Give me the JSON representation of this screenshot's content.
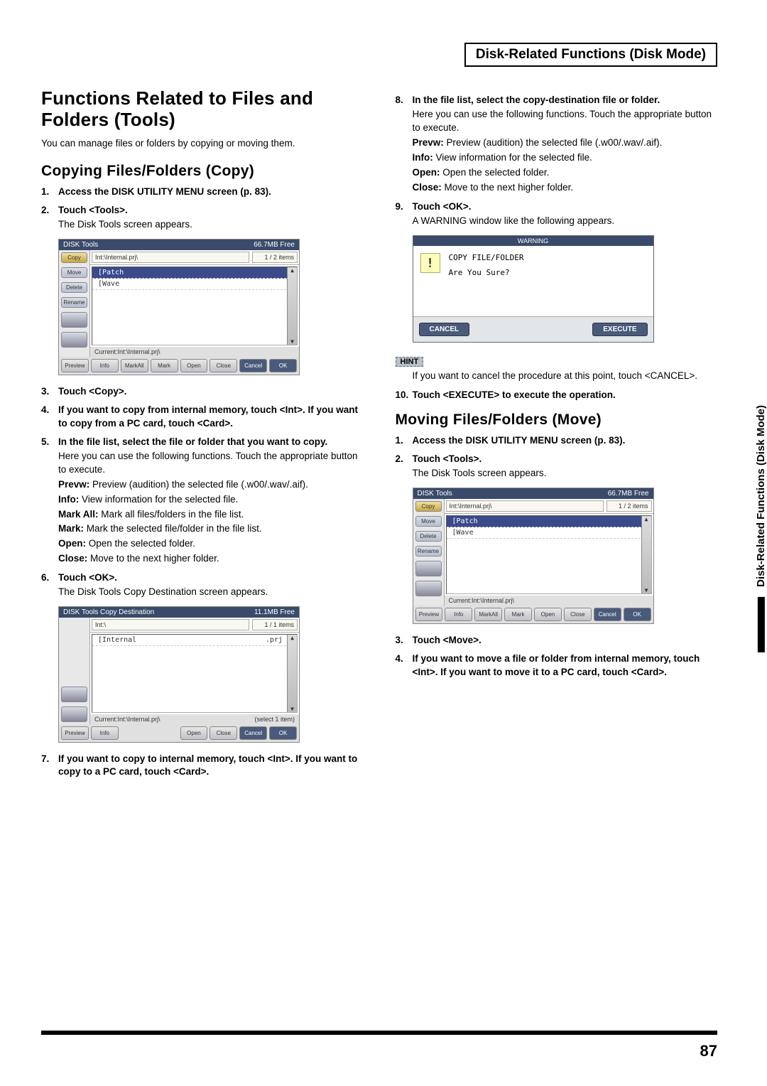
{
  "header_box": "Disk-Related Functions (Disk Mode)",
  "side_tab": "Disk-Related Functions (Disk Mode)",
  "page_number": "87",
  "left": {
    "h1": "Functions Related to Files and Folders (Tools)",
    "intro": "You can manage files or folders by copying or moving them.",
    "h2": "Copying Files/Folders (Copy)",
    "s1": "Access the DISK UTILITY MENU screen (p. 83).",
    "s2": "Touch <Tools>.",
    "s2_body": "The Disk Tools screen appears.",
    "s3": "Touch <Copy>.",
    "s4": "If you want to copy from internal memory, touch <Int>. If you want to copy from a PC card, touch <Card>.",
    "s5": "In the file list, select the file or folder that you want to copy.",
    "s5_body": "Here you can use the following functions. Touch the appropriate button to execute.",
    "d_prevw_t": "Prevw:",
    "d_prevw_v": " Preview (audition) the selected file (.w00/.wav/.aif).",
    "d_info_t": "Info:",
    "d_info_v": " View information for the selected file.",
    "d_markall_t": "Mark All:",
    "d_markall_v": " Mark all files/folders in the file list.",
    "d_mark_t": "Mark:",
    "d_mark_v": " Mark the selected file/folder in the file list.",
    "d_open_t": "Open:",
    "d_open_v": " Open the selected folder.",
    "d_close_t": "Close:",
    "d_close_v": " Move to the next higher folder.",
    "s6": "Touch <OK>.",
    "s6_body": "The Disk Tools Copy Destination screen appears.",
    "s7": "If you want to copy to internal memory, touch <Int>. If you want to copy to a PC card, touch <Card>."
  },
  "right": {
    "s8": "In the file list, select the copy-destination file or folder.",
    "s8_body": "Here you can use the following functions. Touch the appropriate button to execute.",
    "d_prevw_t": "Prevw:",
    "d_prevw_v": " Preview (audition) the selected file (.w00/.wav/.aif).",
    "d_info_t": "Info:",
    "d_info_v": " View information for the selected file.",
    "d_open_t": "Open:",
    "d_open_v": " Open the selected folder.",
    "d_close_t": "Close:",
    "d_close_v": " Move to the next higher folder.",
    "s9": "Touch <OK>.",
    "s9_body": "A WARNING window like the following appears.",
    "hint_label": "HINT",
    "hint_body": "If you want to cancel the procedure at this point, touch <CANCEL>.",
    "s10": "Touch <EXECUTE> to execute the operation.",
    "h2": "Moving Files/Folders (Move)",
    "m1": "Access the DISK UTILITY MENU screen (p. 83).",
    "m2": "Touch <Tools>.",
    "m2_body": "The Disk Tools screen appears.",
    "m3": "Touch <Move>.",
    "m4": "If you want to move a file or folder from internal memory, touch <Int>. If you want to move it to a PC card, touch <Card>."
  },
  "fig_disktools": {
    "title": "DISK Tools",
    "free": "66.7MB Free",
    "path": "Int:\\Internal.prj\\",
    "items": "1 / 2 items",
    "rows": [
      {
        "name": "[Patch",
        "mark": "]"
      },
      {
        "name": "[Wave",
        "mark": "]"
      }
    ],
    "foot": "Current:Int:\\Internal.prj\\",
    "side": [
      "Copy",
      "Move",
      "Delete",
      "Rename"
    ],
    "btns": [
      "Preview",
      "Info",
      "MarkAll",
      "Mark",
      "Open",
      "Close",
      "Cancel",
      "OK"
    ]
  },
  "fig_copydest": {
    "title": "DISK Tools Copy Destination",
    "free": "11.1MB Free",
    "path": "Int:\\",
    "items": "1 / 1 items",
    "rows": [
      {
        "name": "[Internal",
        "mark": ".prj ]"
      }
    ],
    "foot": "Current:Int:\\Internal.prj\\",
    "foot2": "(select 1 item)",
    "btns": [
      "Preview",
      "Info",
      "",
      "",
      "Open",
      "Close",
      "Cancel",
      "OK"
    ]
  },
  "fig_warning": {
    "title": "WARNING",
    "line1": "COPY FILE/FOLDER",
    "line2": "Are You Sure?",
    "cancel": "CANCEL",
    "execute": "EXECUTE"
  },
  "fig_disktools2": {
    "title": "DISK Tools",
    "free": "66.7MB Free",
    "path": "Int:\\Internal.prj\\",
    "items": "1 / 2 items",
    "rows": [
      {
        "name": "[Patch",
        "mark": "]"
      },
      {
        "name": "[Wave",
        "mark": "]"
      }
    ],
    "foot": "Current:Int:\\Internal.prj\\",
    "side": [
      "Copy",
      "Move",
      "Delete",
      "Rename"
    ],
    "btns": [
      "Preview",
      "Info",
      "MarkAll",
      "Mark",
      "Open",
      "Close",
      "Cancel",
      "OK"
    ]
  }
}
